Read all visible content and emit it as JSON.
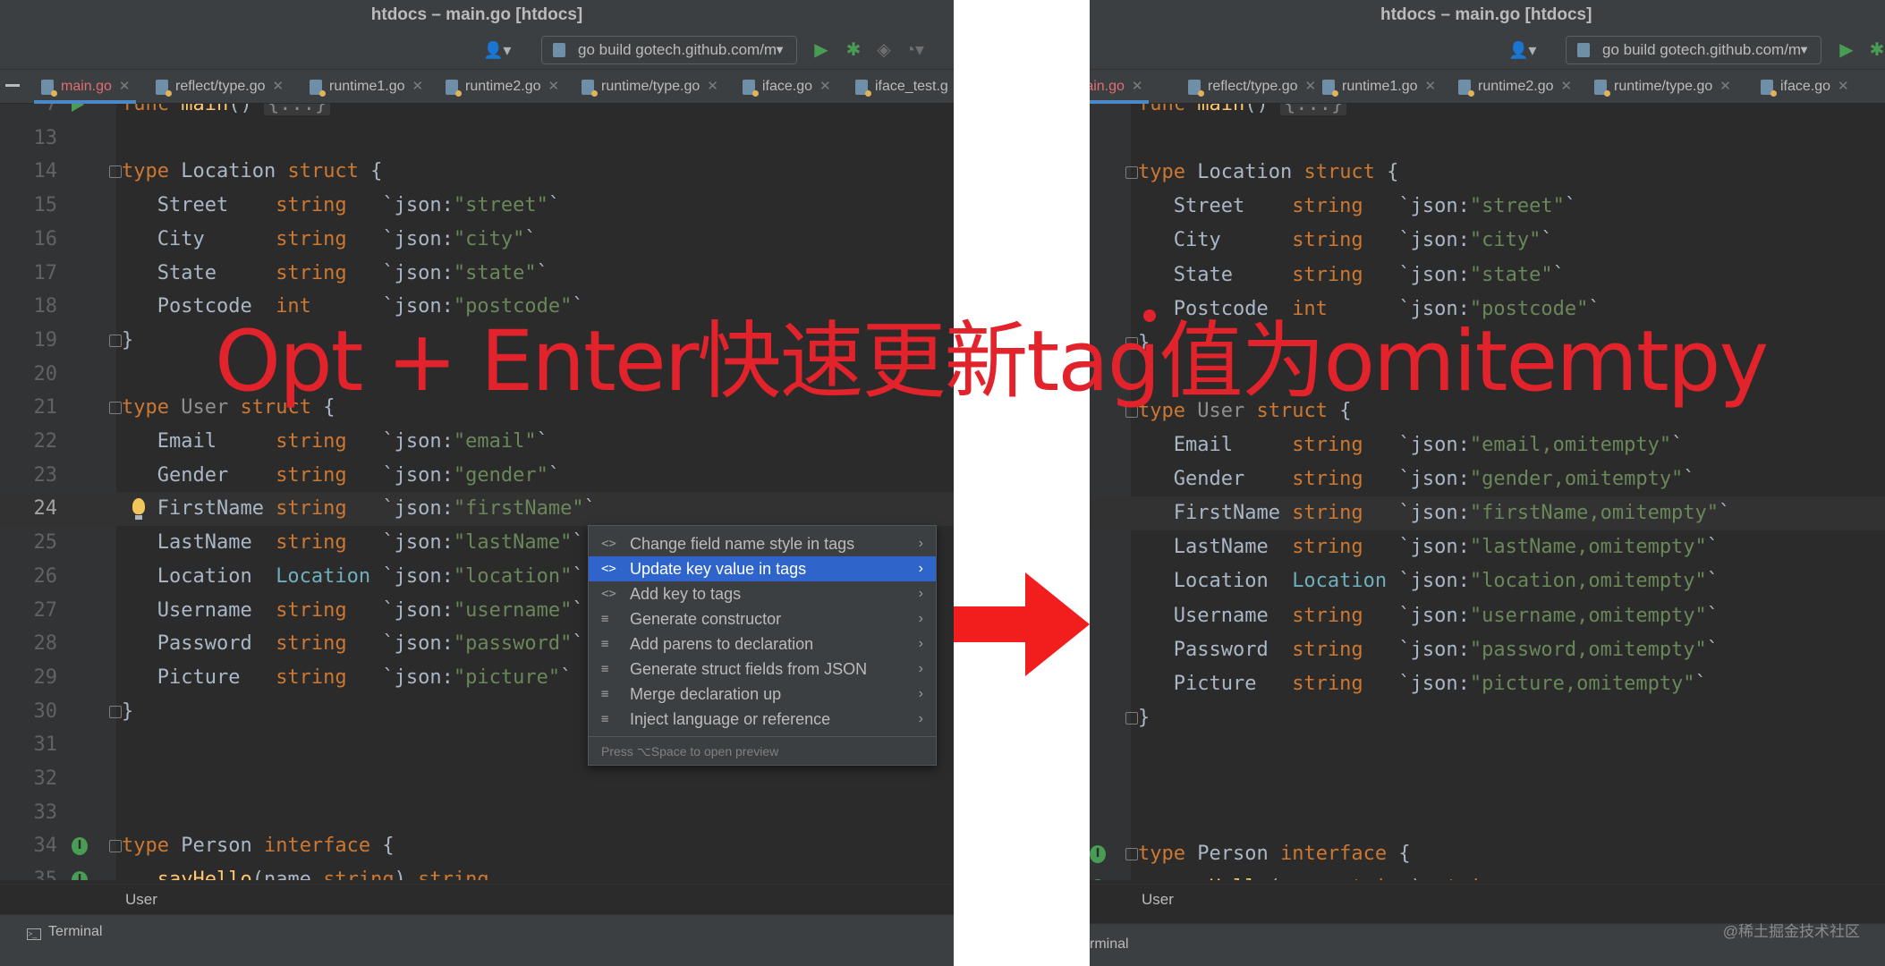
{
  "left": {
    "window_title": "htdocs – main.go [htdocs]",
    "run_config": "go build gotech.github.com/m",
    "tabs": [
      {
        "label": "main.go",
        "active": true
      },
      {
        "label": "reflect/type.go"
      },
      {
        "label": "runtime1.go"
      },
      {
        "label": "runtime2.go"
      },
      {
        "label": "runtime/type.go"
      },
      {
        "label": "iface.go"
      },
      {
        "label": "iface_test.g"
      }
    ],
    "lines": [
      {
        "n": "7",
        "folded": "{...}"
      },
      {
        "n": "13"
      },
      {
        "n": "14",
        "kw": "type",
        "name": "Location",
        "kind": "struct",
        "brace": "{"
      },
      {
        "n": "15",
        "field": "Street",
        "type": "string",
        "tag_key": "`json:",
        "tag_val": "\"street\"",
        "tail": "`"
      },
      {
        "n": "16",
        "field": "City",
        "type": "string",
        "tag_key": "`json:",
        "tag_val": "\"city\"",
        "tail": "`"
      },
      {
        "n": "17",
        "field": "State",
        "type": "string",
        "tag_key": "`json:",
        "tag_val": "\"state\"",
        "tail": "`"
      },
      {
        "n": "18",
        "field": "Postcode",
        "type": "int",
        "tag_key": "`json:",
        "tag_val": "\"postcode\"",
        "tail": "`"
      },
      {
        "n": "19",
        "close": "}"
      },
      {
        "n": "20"
      },
      {
        "n": "21",
        "kw": "type",
        "name": "User",
        "kind": "struct",
        "brace": "{"
      },
      {
        "n": "22",
        "field": "Email",
        "type": "string",
        "tag_key": "`json:",
        "tag_val": "\"email\"",
        "tail": "`"
      },
      {
        "n": "23",
        "field": "Gender",
        "type": "string",
        "tag_key": "`json:",
        "tag_val": "\"gender\"",
        "tail": "`"
      },
      {
        "n": "24",
        "field": "FirstName",
        "type": "string",
        "tag_key": "`json:",
        "tag_val": "\"firstName\"",
        "tail": "`"
      },
      {
        "n": "25",
        "field": "LastName",
        "type": "string",
        "tag_key": "`json:",
        "tag_val": "\"lastName\"",
        "tail": "`"
      },
      {
        "n": "26",
        "field": "Location",
        "type": "Location",
        "tag_key": "`json:",
        "tag_val": "\"location\"",
        "tail": "`"
      },
      {
        "n": "27",
        "field": "Username",
        "type": "string",
        "tag_key": "`json:",
        "tag_val": "\"username\"",
        "tail": "`"
      },
      {
        "n": "28",
        "field": "Password",
        "type": "string",
        "tag_key": "`json:",
        "tag_val": "\"password\"",
        "tail": "`"
      },
      {
        "n": "29",
        "field": "Picture",
        "type": "string",
        "tag_key": "`json:",
        "tag_val": "\"picture\"",
        "tail": "`"
      },
      {
        "n": "30",
        "close": "}"
      },
      {
        "n": "31"
      },
      {
        "n": "32"
      },
      {
        "n": "33"
      },
      {
        "n": "34",
        "kw": "type",
        "name": "Person",
        "kind": "interface",
        "brace": "{"
      },
      {
        "n": "35",
        "method": "sayHello",
        "params": "(name ",
        "ptype": "string",
        "pclose": ") ",
        "ret": "string"
      }
    ],
    "breadcrumb": "User",
    "terminal": "Terminal",
    "popup": {
      "items": [
        {
          "icon": "<>",
          "label": "Change field name style in tags"
        },
        {
          "icon": "<>",
          "label": "Update key value in tags",
          "selected": true
        },
        {
          "icon": "<>",
          "label": "Add key to tags"
        },
        {
          "icon": "≡",
          "label": "Generate constructor"
        },
        {
          "icon": "≡",
          "label": "Add parens to declaration"
        },
        {
          "icon": "≡",
          "label": "Generate struct fields from JSON"
        },
        {
          "icon": "≡",
          "label": "Merge declaration up"
        },
        {
          "icon": "≡",
          "label": "Inject language or reference"
        }
      ],
      "footer": "Press ⌥Space to open preview"
    }
  },
  "right": {
    "window_title": "htdocs – main.go [htdocs]",
    "run_config": "go build gotech.github.com/m",
    "tabs": [
      {
        "label": "main.go",
        "active": true
      },
      {
        "label": "reflect/type.go"
      },
      {
        "label": "runtime1.go"
      },
      {
        "label": "runtime2.go"
      },
      {
        "label": "runtime/type.go"
      },
      {
        "label": "iface.go"
      }
    ],
    "lines": [
      {
        "folded": "{...}"
      },
      {},
      {
        "kw": "type",
        "name": "Location",
        "kind": "struct",
        "brace": "{"
      },
      {
        "field": "Street",
        "type": "string",
        "tag_key": "`json:",
        "tag_val": "\"street\"",
        "tail": "`"
      },
      {
        "field": "City",
        "type": "string",
        "tag_key": "`json:",
        "tag_val": "\"city\"",
        "tail": "`"
      },
      {
        "field": "State",
        "type": "string",
        "tag_key": "`json:",
        "tag_val": "\"state\"",
        "tail": "`"
      },
      {
        "field": "Postcode",
        "type": "int",
        "tag_key": "`json:",
        "tag_val": "\"postcode\"",
        "tail": "`"
      },
      {
        "close": "}"
      },
      {},
      {
        "kw": "type",
        "name": "User",
        "kind": "struct",
        "brace": "{"
      },
      {
        "field": "Email",
        "type": "string",
        "tag_key": "`json:",
        "tag_val": "\"email,omitempty\"",
        "tail": "`"
      },
      {
        "field": "Gender",
        "type": "string",
        "tag_key": "`json:",
        "tag_val": "\"gender,omitempty\"",
        "tail": "`"
      },
      {
        "field": "FirstName",
        "type": "string",
        "tag_key": "`json:",
        "tag_val": "\"firstName,omitempty\"",
        "tail": "`"
      },
      {
        "field": "LastName",
        "type": "string",
        "tag_key": "`json:",
        "tag_val": "\"lastName,omitempty\"",
        "tail": "`"
      },
      {
        "field": "Location",
        "type": "Location",
        "tag_key": "`json:",
        "tag_val": "\"location,omitempty\"",
        "tail": "`"
      },
      {
        "field": "Username",
        "type": "string",
        "tag_key": "`json:",
        "tag_val": "\"username,omitempty\"",
        "tail": "`"
      },
      {
        "field": "Password",
        "type": "string",
        "tag_key": "`json:",
        "tag_val": "\"password,omitempty\"",
        "tail": "`"
      },
      {
        "field": "Picture",
        "type": "string",
        "tag_key": "`json:",
        "tag_val": "\"picture,omitempty\"",
        "tail": "`"
      },
      {
        "close": "}"
      },
      {},
      {},
      {},
      {
        "kw": "type",
        "name": "Person",
        "kind": "interface",
        "brace": "{"
      },
      {
        "method": "sayHello",
        "params": "(name ",
        "ptype": "string",
        "pclose": ") ",
        "ret": "string"
      }
    ],
    "breadcrumb": "User",
    "terminal": "rminal"
  },
  "overlay_text": "Opt + Enter快速更新tag值为omitemtpy",
  "watermark": "@稀土掘金技术社区",
  "colors": {
    "keyword": "#cc7832",
    "string": "#6a8759",
    "text": "#a9b7c6",
    "selection": "#2f65ca",
    "overlay": "#e3232b",
    "arrow": "#f21d1d"
  }
}
